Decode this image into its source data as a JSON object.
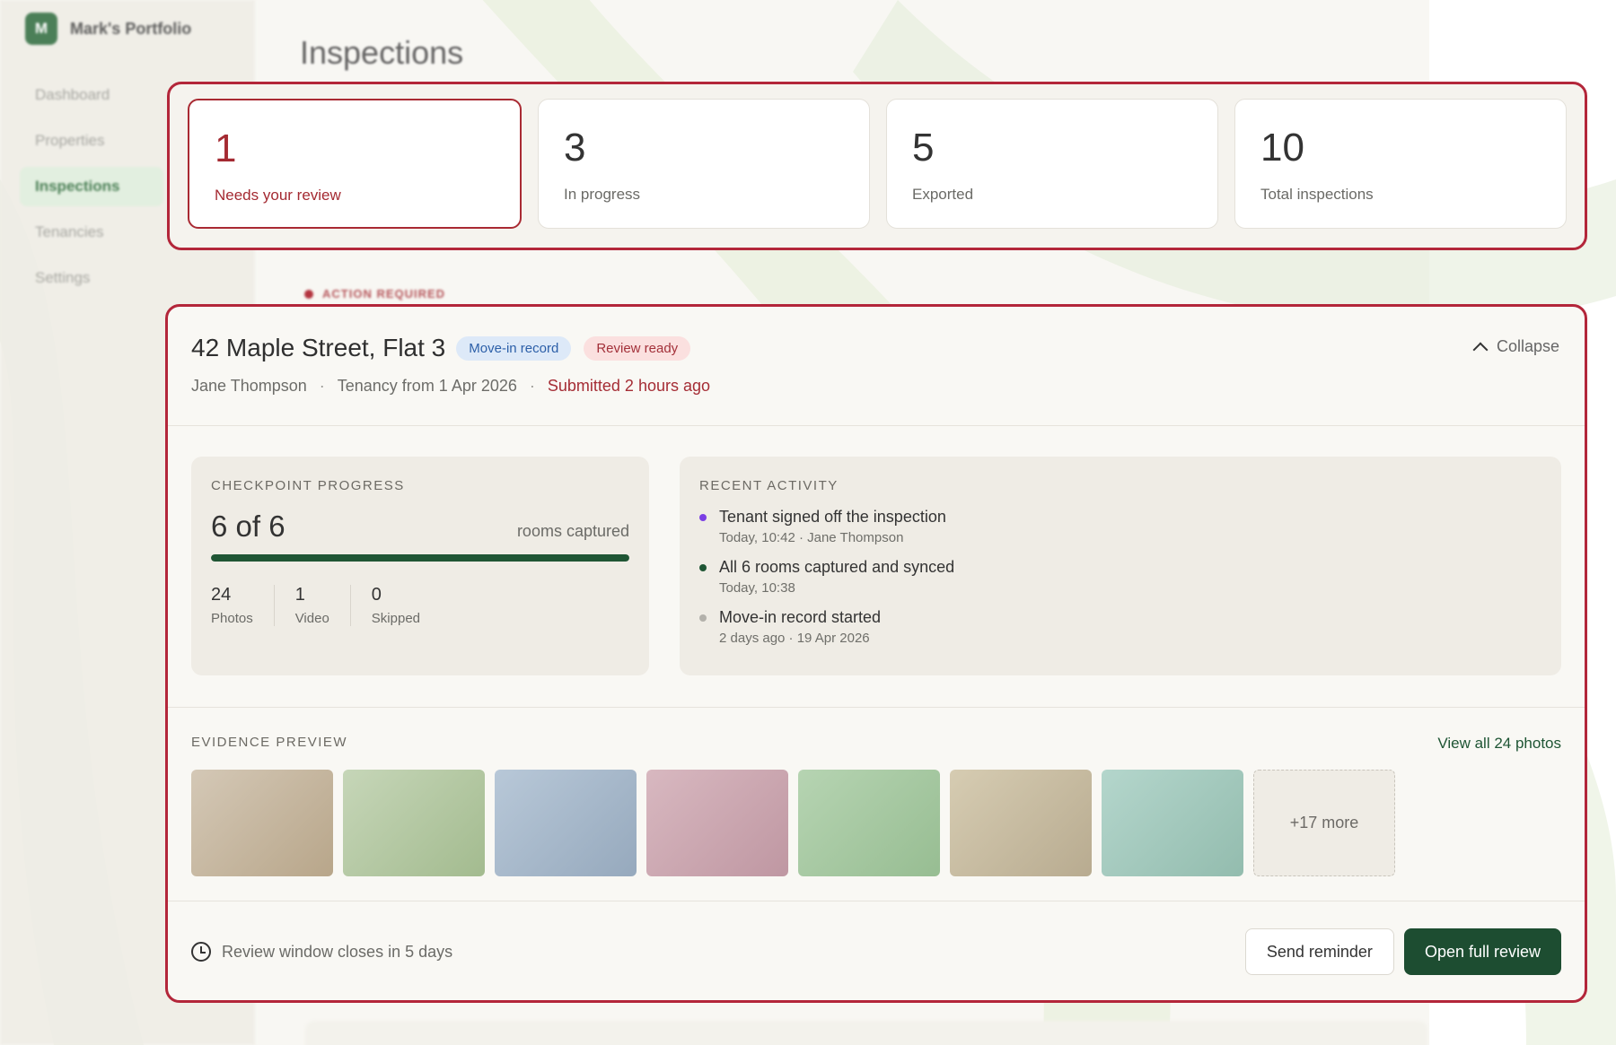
{
  "brand": {
    "initial": "M",
    "name": "Mark's Portfolio"
  },
  "nav": [
    {
      "label": "Dashboard",
      "active": false
    },
    {
      "label": "Properties",
      "active": false
    },
    {
      "label": "Inspections",
      "active": true
    },
    {
      "label": "Tenancies",
      "active": false
    },
    {
      "label": "Settings",
      "active": false
    }
  ],
  "page": {
    "title": "Inspections",
    "section_label": "ACTION REQUIRED"
  },
  "stats": [
    {
      "value": "1",
      "label": "Needs your review"
    },
    {
      "value": "3",
      "label": "In progress"
    },
    {
      "value": "5",
      "label": "Exported"
    },
    {
      "value": "10",
      "label": "Total inspections"
    }
  ],
  "card": {
    "title": "42 Maple Street, Flat 3",
    "tag_type": "Move-in record",
    "tag_status": "Review ready",
    "tenant": "Jane Thompson",
    "tenancy": "Tenancy from 1 Apr 2026",
    "submitted": "Submitted 2 hours ago",
    "meta_sep": "·",
    "collapse_label": "Collapse"
  },
  "progress": {
    "title": "CHECKPOINT PROGRESS",
    "summary": "6 of 6",
    "note": "rooms captured",
    "fraction": 1.0,
    "counts": [
      {
        "value": "24",
        "label": "Photos"
      },
      {
        "value": "1",
        "label": "Video"
      },
      {
        "value": "0",
        "label": "Skipped"
      }
    ]
  },
  "activity": {
    "title": "RECENT ACTIVITY",
    "items": [
      {
        "title": "Tenant signed off the inspection",
        "sub": "Today, 10:42 · Jane Thompson",
        "color": "#7b3fe4"
      },
      {
        "title": "All 6 rooms captured and synced",
        "sub": "Today, 10:38",
        "color": "#1f5534"
      },
      {
        "title": "Move-in record started",
        "sub": "2 days ago · 19 Apr 2026",
        "color": "#b3b1ab"
      }
    ]
  },
  "evidence": {
    "title": "EVIDENCE PREVIEW",
    "link": "View all 24 photos",
    "more_label": "+17 more",
    "thumb_colors": [
      [
        "#d4c8b6",
        "#b8a68a"
      ],
      [
        "#c6d6b8",
        "#a3bb8f"
      ],
      [
        "#b8c8d8",
        "#96a9bd"
      ],
      [
        "#d8b8c0",
        "#bf97a2"
      ],
      [
        "#b6d4b2",
        "#97bd92"
      ],
      [
        "#d6ccb2",
        "#b8ab90"
      ],
      [
        "#b4d6cc",
        "#93bcae"
      ]
    ]
  },
  "footer": {
    "note": "Review window closes in 5 days",
    "send_reminder": "Send reminder",
    "open_review": "Open full review"
  },
  "colors": {
    "accent_red": "#b3263a",
    "brand_green": "#1d4d31",
    "active_nav_bg": "#dfeedd"
  }
}
